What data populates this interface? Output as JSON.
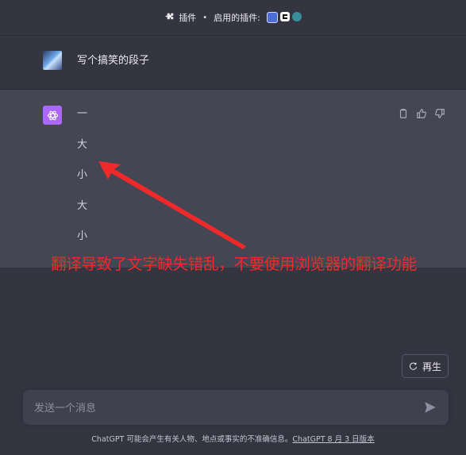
{
  "topbar": {
    "plugins_label": "插件",
    "separator": "•",
    "enabled_label": "启用的插件:",
    "plugin_icons": [
      "plugin-icon-1",
      "plugin-icon-2",
      "plugin-icon-3"
    ]
  },
  "user_message": {
    "text": "写个搞笑的段子"
  },
  "assistant_message": {
    "lines": [
      "一",
      "大",
      "小",
      "大",
      "小"
    ]
  },
  "annotation": {
    "text": "翻译导致了文字缺失错乱，不要使用浏览器的翻译功能",
    "color": "#f02a2a"
  },
  "regenerate": {
    "label": "再生"
  },
  "input": {
    "placeholder": "发送一个消息",
    "value": ""
  },
  "footer": {
    "text": "ChatGPT 可能会产生有关人物、地点或事实的不准确信息。",
    "link": "ChatGPT 8 月 3 日版本"
  },
  "colors": {
    "background": "#343541",
    "assistant_background": "#444654",
    "gpt_avatar": "#ab68ff"
  }
}
